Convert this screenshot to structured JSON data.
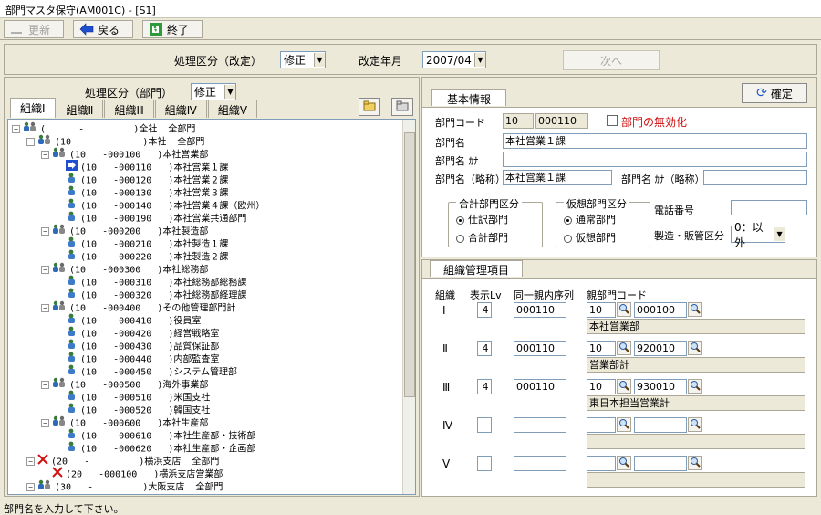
{
  "window": {
    "title": "部門マスタ保守(AM001C) - [S1]"
  },
  "toolbar": {
    "update": "更新",
    "back": "戻る",
    "exit": "終了"
  },
  "header": {
    "proc_label": "処理区分（改定）",
    "proc_value": "修正",
    "rev_label": "改定年月",
    "rev_value": "2007/04",
    "next": "次へ"
  },
  "left": {
    "proc_label": "処理区分（部門）",
    "proc_value": "修正",
    "tabs": [
      "組織Ⅰ",
      "組織Ⅱ",
      "組織Ⅲ",
      "組織Ⅳ",
      "組織Ⅴ"
    ]
  },
  "tree": [
    {
      "level": 0,
      "icon": "people",
      "text": "(      -         )全社  全部門"
    },
    {
      "level": 1,
      "icon": "people",
      "text": "(10   -         )本社  全部門"
    },
    {
      "level": 2,
      "icon": "people",
      "text": "(10   -000100   )本社営業部"
    },
    {
      "level": 3,
      "icon": "arrow",
      "text": "(10   -000110   )本社営業１課"
    },
    {
      "level": 3,
      "icon": "person",
      "text": "(10   -000120   )本社営業２課"
    },
    {
      "level": 3,
      "icon": "person",
      "text": "(10   -000130   )本社営業３課"
    },
    {
      "level": 3,
      "icon": "person",
      "text": "(10   -000140   )本社営業４課（欧州）"
    },
    {
      "level": 3,
      "icon": "person",
      "text": "(10   -000190   )本社営業共通部門"
    },
    {
      "level": 2,
      "icon": "people",
      "text": "(10   -000200   )本社製造部"
    },
    {
      "level": 3,
      "icon": "person",
      "text": "(10   -000210   )本社製造１課"
    },
    {
      "level": 3,
      "icon": "person",
      "text": "(10   -000220   )本社製造２課"
    },
    {
      "level": 2,
      "icon": "people",
      "text": "(10   -000300   )本社総務部"
    },
    {
      "level": 3,
      "icon": "person",
      "text": "(10   -000310   )本社総務部総務課"
    },
    {
      "level": 3,
      "icon": "person",
      "text": "(10   -000320   )本社総務部経理課"
    },
    {
      "level": 2,
      "icon": "people",
      "text": "(10   -000400   )その他管理部門計"
    },
    {
      "level": 3,
      "icon": "person",
      "text": "(10   -000410   )役員室"
    },
    {
      "level": 3,
      "icon": "person",
      "text": "(10   -000420   )経営戦略室"
    },
    {
      "level": 3,
      "icon": "person",
      "text": "(10   -000430   )品質保証部"
    },
    {
      "level": 3,
      "icon": "person",
      "text": "(10   -000440   )内部監査室"
    },
    {
      "level": 3,
      "icon": "person",
      "text": "(10   -000450   )システム管理部"
    },
    {
      "level": 2,
      "icon": "people",
      "text": "(10   -000500   )海外事業部"
    },
    {
      "level": 3,
      "icon": "person",
      "text": "(10   -000510   )米国支社"
    },
    {
      "level": 3,
      "icon": "person",
      "text": "(10   -000520   )韓国支社"
    },
    {
      "level": 2,
      "icon": "people",
      "text": "(10   -000600   )本社生産部"
    },
    {
      "level": 3,
      "icon": "person",
      "text": "(10   -000610   )本社生産部・技術部"
    },
    {
      "level": 3,
      "icon": "person",
      "text": "(10   -000620   )本社生産部・企画部"
    },
    {
      "level": 1,
      "icon": "cross",
      "text": "(20   -         )横浜支店  全部門"
    },
    {
      "level": 2,
      "icon": "cross",
      "text": "(20   -000100   )横浜支店営業部"
    },
    {
      "level": 1,
      "icon": "people",
      "text": "(30   -         )大阪支店  全部門"
    }
  ],
  "basic": {
    "tab": "基本情報",
    "confirm": "確定",
    "code_label": "部門コード",
    "code1": "10",
    "code2": "000110",
    "disable_label": "部門の無効化",
    "name_label": "部門名",
    "name_value": "本社営業１課",
    "kana_label": "部門名 ｶﾅ",
    "kana_value": "",
    "short_label": "部門名（略称）",
    "short_value": "本社営業１課",
    "short_kana_label": "部門名 ｶﾅ（略称）",
    "short_kana_value": "",
    "total_group": "合計部門区分",
    "total_opt1": "仕訳部門",
    "total_opt2": "合計部門",
    "virtual_group": "仮想部門区分",
    "virtual_opt1": "通常部門",
    "virtual_opt2": "仮想部門",
    "phone_label": "電話番号",
    "phone_value": "",
    "mfg_label": "製造・販管区分",
    "mfg_value": "0：以外"
  },
  "org": {
    "tab": "組織管理項目",
    "col_org": "組織",
    "col_lv": "表示Lv",
    "col_order": "同一親内序列",
    "col_parent": "親部門コード",
    "rows": [
      {
        "label": "Ⅰ",
        "lv": "4",
        "order": "000110",
        "p1": "10",
        "p2": "000100",
        "name": "本社営業部"
      },
      {
        "label": "Ⅱ",
        "lv": "4",
        "order": "000110",
        "p1": "10",
        "p2": "920010",
        "name": "営業部計"
      },
      {
        "label": "Ⅲ",
        "lv": "4",
        "order": "000110",
        "p1": "10",
        "p2": "930010",
        "name": "東日本担当営業計"
      },
      {
        "label": "Ⅳ",
        "lv": "",
        "order": "",
        "p1": "",
        "p2": "",
        "name": ""
      },
      {
        "label": "Ⅴ",
        "lv": "",
        "order": "",
        "p1": "",
        "p2": "",
        "name": ""
      }
    ]
  },
  "status": "部門名を入力して下さい。"
}
